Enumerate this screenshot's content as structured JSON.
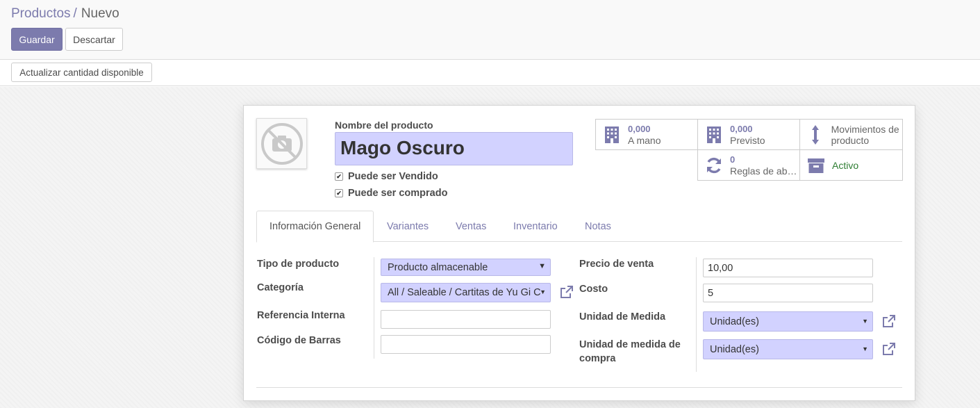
{
  "breadcrumb": {
    "parent": "Productos",
    "separator": "/",
    "current": "Nuevo"
  },
  "toolbar": {
    "save_label": "Guardar",
    "discard_label": "Descartar"
  },
  "statusbar": {
    "update_qty_label": "Actualizar cantidad disponible"
  },
  "product": {
    "name_label": "Nombre del producto",
    "name_value": "Mago Oscuro",
    "can_be_sold_label": "Puede ser Vendido",
    "can_be_sold": true,
    "can_be_purchased_label": "Puede ser comprado",
    "can_be_purchased": true
  },
  "smart_buttons": {
    "on_hand": {
      "value": "0,000",
      "label": "A mano",
      "icon": "building-icon"
    },
    "forecast": {
      "value": "0,000",
      "label": "Previsto",
      "icon": "building-icon"
    },
    "moves": {
      "label": "Movimientos de producto",
      "icon": "arrows-vertical-icon"
    },
    "reorder_rules": {
      "value": "0",
      "label": "Reglas de ab…",
      "icon": "refresh-icon"
    },
    "active": {
      "label": "Activo",
      "icon": "archive-icon",
      "color": "#2e7d32"
    }
  },
  "tabs": [
    {
      "label": "Información General",
      "active": true
    },
    {
      "label": "Variantes"
    },
    {
      "label": "Ventas"
    },
    {
      "label": "Inventario"
    },
    {
      "label": "Notas"
    }
  ],
  "form": {
    "product_type_label": "Tipo de producto",
    "product_type_value": "Producto almacenable",
    "category_label": "Categoría",
    "category_value": "All / Saleable / Cartitas de Yu Gi C",
    "internal_ref_label": "Referencia Interna",
    "internal_ref_value": "",
    "barcode_label": "Código de Barras",
    "barcode_value": "",
    "sale_price_label": "Precio de venta",
    "sale_price_value": "10,00",
    "cost_label": "Costo",
    "cost_value": "5",
    "uom_label": "Unidad de Medida",
    "uom_value": "Unidad(es)",
    "purchase_uom_label": "Unidad de medida de compra",
    "purchase_uom_value": "Unidad(es)"
  },
  "colors": {
    "accent": "#7c7bad",
    "required_bg": "#d2d2ff",
    "active_green": "#2e7d32"
  }
}
